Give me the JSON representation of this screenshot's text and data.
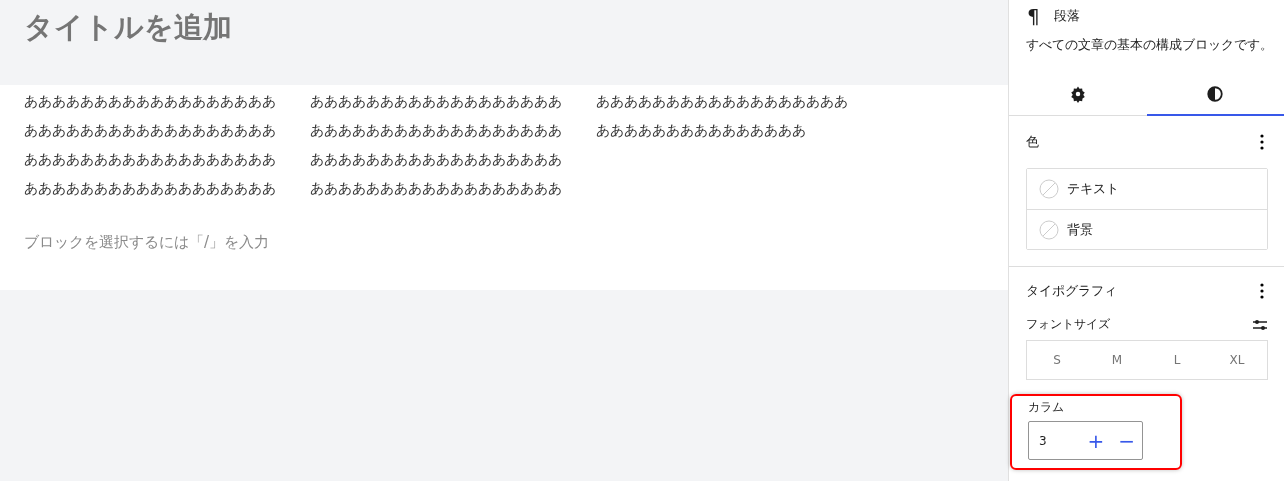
{
  "editor": {
    "title_placeholder": "タイトルを追加",
    "columns": [
      [
        "ああああああああああああああああああ",
        "ああああああああああああああああああ",
        "ああああああああああああああああああ",
        "ああああああああああああああああああ"
      ],
      [
        "ああああああああああああああああああ",
        "ああああああああああああああああああ",
        "ああああああああああああああああああ",
        "ああああああああああああああああああ"
      ],
      [
        "ああああああああああああああああああ",
        "あああああああああああああああ"
      ]
    ],
    "block_placeholder": "ブロックを選択するには「/」を入力"
  },
  "sidebar": {
    "block": {
      "icon": "¶",
      "name": "段落",
      "description": "すべての文章の基本の構成ブロックです。"
    },
    "tabs": [
      {
        "kind": "settings",
        "selected": false
      },
      {
        "kind": "styles",
        "selected": true
      }
    ],
    "color": {
      "title": "色",
      "items": [
        {
          "label": "テキスト"
        },
        {
          "label": "背景"
        }
      ]
    },
    "typography": {
      "title": "タイポグラフィ",
      "font_size_label": "フォントサイズ",
      "sizes": [
        {
          "label": "S",
          "selected": false
        },
        {
          "label": "M",
          "selected": false
        },
        {
          "label": "L",
          "selected": false
        },
        {
          "label": "XL",
          "selected": false
        }
      ]
    },
    "columns_control": {
      "label": "カラム",
      "value": "3",
      "highlighted": true,
      "plus": "+",
      "minus": "−"
    }
  }
}
